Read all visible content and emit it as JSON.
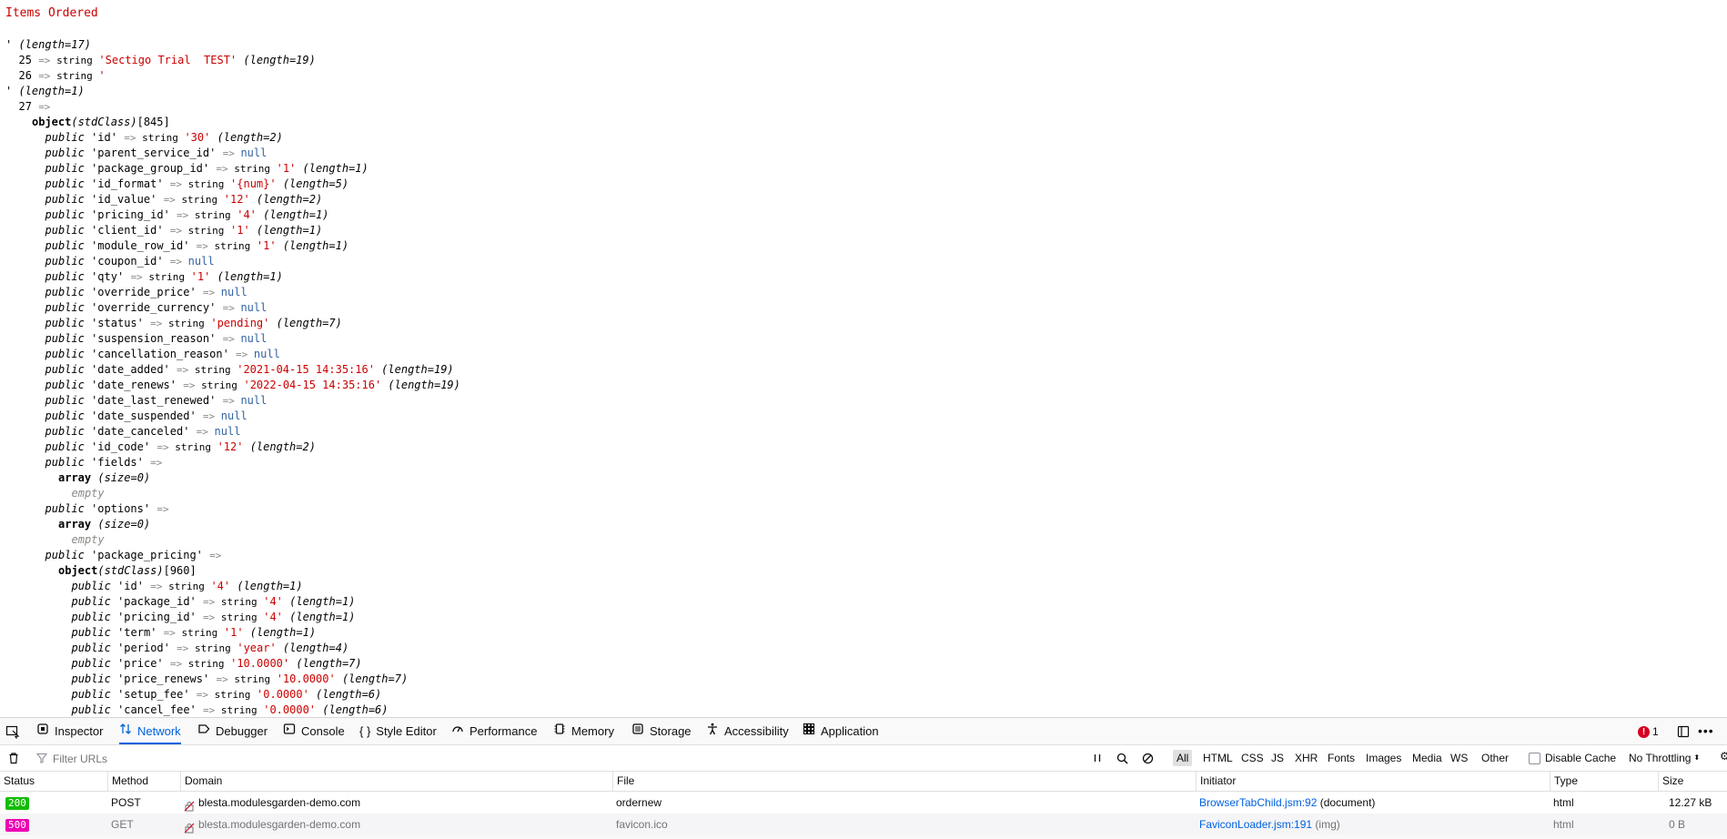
{
  "dump": {
    "heading": "Items Ordered",
    "lines": [
      {
        "i": 0,
        "t": [
          [
            "kw",
            "' (length=17)"
          ]
        ]
      },
      {
        "i": 1,
        "t": [
          [
            "key",
            "25 "
          ],
          [
            "op",
            "=> "
          ],
          [
            "tp",
            "string "
          ],
          [
            "str",
            "'Sectigo Trial  TEST'"
          ],
          [
            "len",
            " (length=19)"
          ]
        ]
      },
      {
        "i": 1,
        "t": [
          [
            "key",
            "26 "
          ],
          [
            "op",
            "=> "
          ],
          [
            "tp",
            "string "
          ],
          [
            "str",
            "'"
          ]
        ]
      },
      {
        "i": 0,
        "t": [
          [
            "kw",
            "' (length=1)"
          ]
        ]
      },
      {
        "i": 1,
        "t": [
          [
            "key",
            "27 "
          ],
          [
            "op",
            "=>"
          ]
        ]
      },
      {
        "i": 2,
        "t": [
          [
            "bold",
            "object"
          ],
          [
            "kw",
            "(stdClass)"
          ],
          [
            "key",
            "[845]"
          ]
        ]
      },
      {
        "i": 3,
        "t": [
          [
            "kw",
            "public "
          ],
          [
            "key",
            "'id' "
          ],
          [
            "op",
            "=> "
          ],
          [
            "tp",
            "string "
          ],
          [
            "str",
            "'30'"
          ],
          [
            "len",
            " (length=2)"
          ]
        ]
      },
      {
        "i": 3,
        "t": [
          [
            "kw",
            "public "
          ],
          [
            "key",
            "'parent_service_id' "
          ],
          [
            "op",
            "=> "
          ],
          [
            "nul",
            "null"
          ]
        ]
      },
      {
        "i": 3,
        "t": [
          [
            "kw",
            "public "
          ],
          [
            "key",
            "'package_group_id' "
          ],
          [
            "op",
            "=> "
          ],
          [
            "tp",
            "string "
          ],
          [
            "str",
            "'1'"
          ],
          [
            "len",
            " (length=1)"
          ]
        ]
      },
      {
        "i": 3,
        "t": [
          [
            "kw",
            "public "
          ],
          [
            "key",
            "'id_format' "
          ],
          [
            "op",
            "=> "
          ],
          [
            "tp",
            "string "
          ],
          [
            "str",
            "'{num}'"
          ],
          [
            "len",
            " (length=5)"
          ]
        ]
      },
      {
        "i": 3,
        "t": [
          [
            "kw",
            "public "
          ],
          [
            "key",
            "'id_value' "
          ],
          [
            "op",
            "=> "
          ],
          [
            "tp",
            "string "
          ],
          [
            "str",
            "'12'"
          ],
          [
            "len",
            " (length=2)"
          ]
        ]
      },
      {
        "i": 3,
        "t": [
          [
            "kw",
            "public "
          ],
          [
            "key",
            "'pricing_id' "
          ],
          [
            "op",
            "=> "
          ],
          [
            "tp",
            "string "
          ],
          [
            "str",
            "'4'"
          ],
          [
            "len",
            " (length=1)"
          ]
        ]
      },
      {
        "i": 3,
        "t": [
          [
            "kw",
            "public "
          ],
          [
            "key",
            "'client_id' "
          ],
          [
            "op",
            "=> "
          ],
          [
            "tp",
            "string "
          ],
          [
            "str",
            "'1'"
          ],
          [
            "len",
            " (length=1)"
          ]
        ]
      },
      {
        "i": 3,
        "t": [
          [
            "kw",
            "public "
          ],
          [
            "key",
            "'module_row_id' "
          ],
          [
            "op",
            "=> "
          ],
          [
            "tp",
            "string "
          ],
          [
            "str",
            "'1'"
          ],
          [
            "len",
            " (length=1)"
          ]
        ]
      },
      {
        "i": 3,
        "t": [
          [
            "kw",
            "public "
          ],
          [
            "key",
            "'coupon_id' "
          ],
          [
            "op",
            "=> "
          ],
          [
            "nul",
            "null"
          ]
        ]
      },
      {
        "i": 3,
        "t": [
          [
            "kw",
            "public "
          ],
          [
            "key",
            "'qty' "
          ],
          [
            "op",
            "=> "
          ],
          [
            "tp",
            "string "
          ],
          [
            "str",
            "'1'"
          ],
          [
            "len",
            " (length=1)"
          ]
        ]
      },
      {
        "i": 3,
        "t": [
          [
            "kw",
            "public "
          ],
          [
            "key",
            "'override_price' "
          ],
          [
            "op",
            "=> "
          ],
          [
            "nul",
            "null"
          ]
        ]
      },
      {
        "i": 3,
        "t": [
          [
            "kw",
            "public "
          ],
          [
            "key",
            "'override_currency' "
          ],
          [
            "op",
            "=> "
          ],
          [
            "nul",
            "null"
          ]
        ]
      },
      {
        "i": 3,
        "t": [
          [
            "kw",
            "public "
          ],
          [
            "key",
            "'status' "
          ],
          [
            "op",
            "=> "
          ],
          [
            "tp",
            "string "
          ],
          [
            "str",
            "'pending'"
          ],
          [
            "len",
            " (length=7)"
          ]
        ]
      },
      {
        "i": 3,
        "t": [
          [
            "kw",
            "public "
          ],
          [
            "key",
            "'suspension_reason' "
          ],
          [
            "op",
            "=> "
          ],
          [
            "nul",
            "null"
          ]
        ]
      },
      {
        "i": 3,
        "t": [
          [
            "kw",
            "public "
          ],
          [
            "key",
            "'cancellation_reason' "
          ],
          [
            "op",
            "=> "
          ],
          [
            "nul",
            "null"
          ]
        ]
      },
      {
        "i": 3,
        "t": [
          [
            "kw",
            "public "
          ],
          [
            "key",
            "'date_added' "
          ],
          [
            "op",
            "=> "
          ],
          [
            "tp",
            "string "
          ],
          [
            "str",
            "'2021-04-15 14:35:16'"
          ],
          [
            "len",
            " (length=19)"
          ]
        ]
      },
      {
        "i": 3,
        "t": [
          [
            "kw",
            "public "
          ],
          [
            "key",
            "'date_renews' "
          ],
          [
            "op",
            "=> "
          ],
          [
            "tp",
            "string "
          ],
          [
            "str",
            "'2022-04-15 14:35:16'"
          ],
          [
            "len",
            " (length=19)"
          ]
        ]
      },
      {
        "i": 3,
        "t": [
          [
            "kw",
            "public "
          ],
          [
            "key",
            "'date_last_renewed' "
          ],
          [
            "op",
            "=> "
          ],
          [
            "nul",
            "null"
          ]
        ]
      },
      {
        "i": 3,
        "t": [
          [
            "kw",
            "public "
          ],
          [
            "key",
            "'date_suspended' "
          ],
          [
            "op",
            "=> "
          ],
          [
            "nul",
            "null"
          ]
        ]
      },
      {
        "i": 3,
        "t": [
          [
            "kw",
            "public "
          ],
          [
            "key",
            "'date_canceled' "
          ],
          [
            "op",
            "=> "
          ],
          [
            "nul",
            "null"
          ]
        ]
      },
      {
        "i": 3,
        "t": [
          [
            "kw",
            "public "
          ],
          [
            "key",
            "'id_code' "
          ],
          [
            "op",
            "=> "
          ],
          [
            "tp",
            "string "
          ],
          [
            "str",
            "'12'"
          ],
          [
            "len",
            " (length=2)"
          ]
        ]
      },
      {
        "i": 3,
        "t": [
          [
            "kw",
            "public "
          ],
          [
            "key",
            "'fields' "
          ],
          [
            "op",
            "=>"
          ]
        ]
      },
      {
        "i": 4,
        "t": [
          [
            "bold",
            "array"
          ],
          [
            "len",
            " (size=0)"
          ]
        ]
      },
      {
        "i": 5,
        "t": [
          [
            "em",
            "empty"
          ]
        ]
      },
      {
        "i": 3,
        "t": [
          [
            "kw",
            "public "
          ],
          [
            "key",
            "'options' "
          ],
          [
            "op",
            "=>"
          ]
        ]
      },
      {
        "i": 4,
        "t": [
          [
            "bold",
            "array"
          ],
          [
            "len",
            " (size=0)"
          ]
        ]
      },
      {
        "i": 5,
        "t": [
          [
            "em",
            "empty"
          ]
        ]
      },
      {
        "i": 3,
        "t": [
          [
            "kw",
            "public "
          ],
          [
            "key",
            "'package_pricing' "
          ],
          [
            "op",
            "=>"
          ]
        ]
      },
      {
        "i": 4,
        "t": [
          [
            "bold",
            "object"
          ],
          [
            "kw",
            "(stdClass)"
          ],
          [
            "key",
            "[960]"
          ]
        ]
      },
      {
        "i": 5,
        "t": [
          [
            "kw",
            "public "
          ],
          [
            "key",
            "'id' "
          ],
          [
            "op",
            "=> "
          ],
          [
            "tp",
            "string "
          ],
          [
            "str",
            "'4'"
          ],
          [
            "len",
            " (length=1)"
          ]
        ]
      },
      {
        "i": 5,
        "t": [
          [
            "kw",
            "public "
          ],
          [
            "key",
            "'package_id' "
          ],
          [
            "op",
            "=> "
          ],
          [
            "tp",
            "string "
          ],
          [
            "str",
            "'4'"
          ],
          [
            "len",
            " (length=1)"
          ]
        ]
      },
      {
        "i": 5,
        "t": [
          [
            "kw",
            "public "
          ],
          [
            "key",
            "'pricing_id' "
          ],
          [
            "op",
            "=> "
          ],
          [
            "tp",
            "string "
          ],
          [
            "str",
            "'4'"
          ],
          [
            "len",
            " (length=1)"
          ]
        ]
      },
      {
        "i": 5,
        "t": [
          [
            "kw",
            "public "
          ],
          [
            "key",
            "'term' "
          ],
          [
            "op",
            "=> "
          ],
          [
            "tp",
            "string "
          ],
          [
            "str",
            "'1'"
          ],
          [
            "len",
            " (length=1)"
          ]
        ]
      },
      {
        "i": 5,
        "t": [
          [
            "kw",
            "public "
          ],
          [
            "key",
            "'period' "
          ],
          [
            "op",
            "=> "
          ],
          [
            "tp",
            "string "
          ],
          [
            "str",
            "'year'"
          ],
          [
            "len",
            " (length=4)"
          ]
        ]
      },
      {
        "i": 5,
        "t": [
          [
            "kw",
            "public "
          ],
          [
            "key",
            "'price' "
          ],
          [
            "op",
            "=> "
          ],
          [
            "tp",
            "string "
          ],
          [
            "str",
            "'10.0000'"
          ],
          [
            "len",
            " (length=7)"
          ]
        ]
      },
      {
        "i": 5,
        "t": [
          [
            "kw",
            "public "
          ],
          [
            "key",
            "'price_renews' "
          ],
          [
            "op",
            "=> "
          ],
          [
            "tp",
            "string "
          ],
          [
            "str",
            "'10.0000'"
          ],
          [
            "len",
            " (length=7)"
          ]
        ]
      },
      {
        "i": 5,
        "t": [
          [
            "kw",
            "public "
          ],
          [
            "key",
            "'setup_fee' "
          ],
          [
            "op",
            "=> "
          ],
          [
            "tp",
            "string "
          ],
          [
            "str",
            "'0.0000'"
          ],
          [
            "len",
            " (length=6)"
          ]
        ]
      },
      {
        "i": 5,
        "t": [
          [
            "kw",
            "public "
          ],
          [
            "key",
            "'cancel_fee' "
          ],
          [
            "op",
            "=> "
          ],
          [
            "tp",
            "string "
          ],
          [
            "str",
            "'0.0000'"
          ],
          [
            "len",
            " (length=6)"
          ]
        ]
      }
    ]
  },
  "devtools": {
    "tabs": [
      {
        "label": "Inspector",
        "icon": "inspector-icon"
      },
      {
        "label": "Network",
        "icon": "network-icon",
        "active": true
      },
      {
        "label": "Debugger",
        "icon": "debugger-icon"
      },
      {
        "label": "Console",
        "icon": "console-icon"
      },
      {
        "label": "Style Editor",
        "icon": "style-editor-icon"
      },
      {
        "label": "Performance",
        "icon": "performance-icon"
      },
      {
        "label": "Memory",
        "icon": "memory-icon"
      },
      {
        "label": "Storage",
        "icon": "storage-icon"
      },
      {
        "label": "Accessibility",
        "icon": "accessibility-icon"
      },
      {
        "label": "Application",
        "icon": "application-icon"
      }
    ],
    "error_count": "1",
    "filter_placeholder": "Filter URLs",
    "type_filters": [
      "All",
      "HTML",
      "CSS",
      "JS",
      "XHR",
      "Fonts",
      "Images",
      "Media",
      "WS",
      "Other"
    ],
    "disable_cache_label": "Disable Cache",
    "throttling_label": "No Throttling",
    "columns": [
      "Status",
      "Method",
      "Domain",
      "File",
      "Initiator",
      "Type",
      "Size"
    ],
    "requests": [
      {
        "status": "200",
        "status_color": "#12bc00",
        "method": "POST",
        "domain": "blesta.modulesgarden-demo.com",
        "file": "ordernew",
        "initiator_link": "BrowserTabChild.jsm:92",
        "initiator_note": "(document)",
        "type": "html",
        "size": "12.27 kB"
      },
      {
        "status": "500",
        "status_color": "#ed00b5",
        "method": "GET",
        "domain": "blesta.modulesgarden-demo.com",
        "file": "favicon.ico",
        "initiator_link": "FaviconLoader.jsm:191",
        "initiator_note": "(img)",
        "type": "html",
        "size": "0 B"
      }
    ]
  }
}
